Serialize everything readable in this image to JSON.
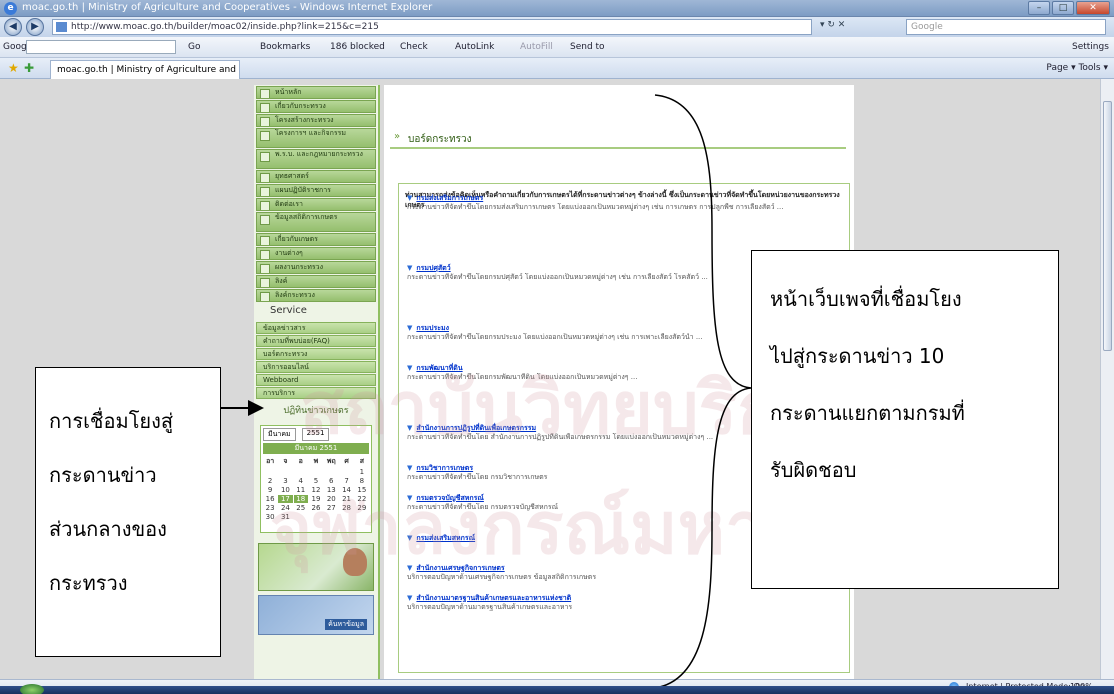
{
  "browser": {
    "title": "moac.go.th | Ministry of Agriculture and Cooperatives - Windows Internet Explorer",
    "address": "http://www.moac.go.th/builder/moac02/inside.php?link=215&c=215",
    "search_placeholder": "Google",
    "tab_label": "moac.go.th | Ministry of Agriculture and Coopera...",
    "google_label": "Google",
    "toolbar_go": "Go",
    "toolbar_bookmarks": "Bookmarks",
    "toolbar_blocked": "186 blocked",
    "toolbar_check": "Check",
    "toolbar_autolink": "AutoLink",
    "toolbar_autofill": "AutoFill",
    "toolbar_sendto": "Send to",
    "toolbar_settings": "Settings",
    "tab_tools": "Page ▾  Tools ▾",
    "status_zone": "Internet | Protected Mode: On",
    "zoom": "100%"
  },
  "nav": {
    "items": [
      "หน้าหลัก",
      "เกี่ยวกับกระทรวง",
      "โครงสร้างกระทรวง",
      "โครงการฯ และกิจกรรม",
      "พ.ร.บ. และกฎหมายกระทรวง",
      "ยุทธศาสตร์",
      "แผนปฏิบัติราชการ",
      "ติดต่อเรา",
      "ข้อมูลสถิติการเกษตร",
      "เกี่ยวกับเกษตร",
      "งานต่างๆ",
      "ผลงานกระทรวง",
      "ลิงค์",
      "ลิงค์กระทรวง"
    ],
    "service_label": "Service",
    "service_items": [
      "ข้อมูลข่าวสาร",
      "คำถามที่พบบ่อย(FAQ)",
      "บอร์ดกระทรวง",
      "บริการออนไลน์",
      "Webboard",
      "การบริการ"
    ],
    "sub_heading": "ปฏิทินข่าวเกษตร"
  },
  "calendar": {
    "month": "มีนาคม",
    "year": "2551",
    "header": "มีนาคม 2551",
    "days": [
      "อา",
      "จ",
      "อ",
      "พ",
      "พฤ",
      "ศ",
      "ส"
    ],
    "dates": [
      "",
      "",
      "",
      "",
      "",
      "",
      "1",
      "2",
      "3",
      "4",
      "5",
      "6",
      "7",
      "8",
      "9",
      "10",
      "11",
      "12",
      "13",
      "14",
      "15",
      "16",
      "17",
      "18",
      "19",
      "20",
      "21",
      "22",
      "23",
      "24",
      "25",
      "26",
      "27",
      "28",
      "29",
      "30",
      "31"
    ]
  },
  "banner": {
    "caption": "ค้นหาข้อมูล"
  },
  "main": {
    "title": "บอร์ดกระทรวง",
    "intro": "ท่านสามารถส่งข้อคิดเห็นหรือคำถามเกี่ยวกับการเกษตรได้ที่กระดานข่าวต่างๆ ข้างล่างนี้ ซึ่งเป็นกระดานข่าวที่จัดทำขึ้นโดยหน่วยงานของกระทรวงเกษตร",
    "entries": [
      {
        "head": "กรมส่งเสริมการเกษตร",
        "text": "กระดานข่าวที่จัดทำขึ้นโดยกรมส่งเสริมการเกษตร โดยแบ่งออกเป็นหมวดหมู่ต่างๆ เช่น การเกษตร การปลูกพืช การเลี้ยงสัตว์ ..."
      },
      {
        "head": "กรมปศุสัตว์",
        "text": "กระดานข่าวที่จัดทำขึ้นโดยกรมปศุสัตว์ โดยแบ่งออกเป็นหมวดหมู่ต่างๆ เช่น การเลี้ยงสัตว์ โรคสัตว์ ..."
      },
      {
        "head": "กรมประมง",
        "text": "กระดานข่าวที่จัดทำขึ้นโดยกรมประมง โดยแบ่งออกเป็นหมวดหมู่ต่างๆ เช่น การเพาะเลี้ยงสัตว์น้ำ ..."
      },
      {
        "head": "กรมพัฒนาที่ดิน",
        "text": "กระดานข่าวที่จัดทำขึ้นโดยกรมพัฒนาที่ดิน โดยแบ่งออกเป็นหมวดหมู่ต่างๆ ..."
      },
      {
        "head": "สำนักงานการปฏิรูปที่ดินเพื่อเกษตรกรรม",
        "text": "กระดานข่าวที่จัดทำขึ้นโดย สำนักงานการปฏิรูปที่ดินเพื่อเกษตรกรรม โดยแบ่งออกเป็นหมวดหมู่ต่างๆ ..."
      },
      {
        "head": "กรมวิชาการเกษตร",
        "text": "กระดานข่าวที่จัดทำขึ้นโดย กรมวิชาการเกษตร"
      },
      {
        "head": "กรมตรวจบัญชีสหกรณ์",
        "text": "กระดานข่าวที่จัดทำขึ้นโดย กรมตรวจบัญชีสหกรณ์"
      },
      {
        "head": "กรมส่งเสริมสหกรณ์",
        "text": ""
      },
      {
        "head": "สำนักงานเศรษฐกิจการเกษตร",
        "text": "บริการตอบปัญหาด้านเศรษฐกิจการเกษตร ข้อมูลสถิติการเกษตร"
      },
      {
        "head": "สำนักงานมาตรฐานสินค้าเกษตรและอาหารแห่งชาติ",
        "text": "บริการตอบปัญหาด้านมาตรฐานสินค้าเกษตรและอาหาร"
      }
    ]
  },
  "annotations": {
    "left_lines": [
      "การเชื่อมโยงสู่",
      "กระดานข่าว",
      "ส่วนกลางของ",
      "กระทรวง"
    ],
    "right_lines": [
      "หน้าเว็บเพจที่เชื่อมโยง",
      "ไปสู่กระดานข่าว 10",
      "กระดานแยกตามกรมที่",
      "รับผิดชอบ"
    ]
  },
  "watermark": {
    "line1": "สถาบันวิทยบริการ",
    "line2": "จุฬาลงกรณ์มหาวิทยาลัย"
  }
}
